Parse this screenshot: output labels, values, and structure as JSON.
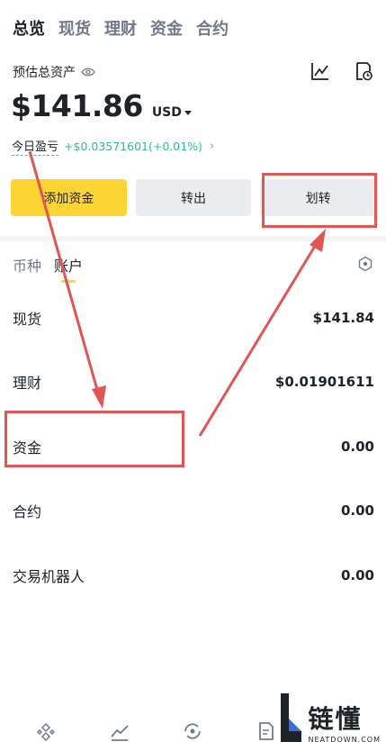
{
  "top_tabs": [
    {
      "label": "总览"
    },
    {
      "label": "现货"
    },
    {
      "label": "理财"
    },
    {
      "label": "资金"
    },
    {
      "label": "合约"
    }
  ],
  "overview": {
    "est_label": "预估总资产",
    "balance": "$141.86",
    "currency": "USD",
    "pnl_label": "今日盈亏",
    "pnl_value": "+$0.03571601(+0.01%)"
  },
  "buttons": {
    "deposit": "添加资金",
    "withdraw": "转出",
    "transfer": "划转"
  },
  "sub_tabs": [
    {
      "label": "币种"
    },
    {
      "label": "账户"
    }
  ],
  "accounts": [
    {
      "name": "现货",
      "value": "$141.84"
    },
    {
      "name": "理财",
      "value": "$0.01901611"
    },
    {
      "name": "资金",
      "value": "0.00"
    },
    {
      "name": "合约",
      "value": "0.00"
    },
    {
      "name": "交易机器人",
      "value": "0.00"
    }
  ],
  "watermark": {
    "cn": "链懂",
    "en": "NEATDOWN.COM"
  },
  "colors": {
    "accent": "#fcd535",
    "positive": "#2ebd85",
    "annotation": "#e25555"
  }
}
